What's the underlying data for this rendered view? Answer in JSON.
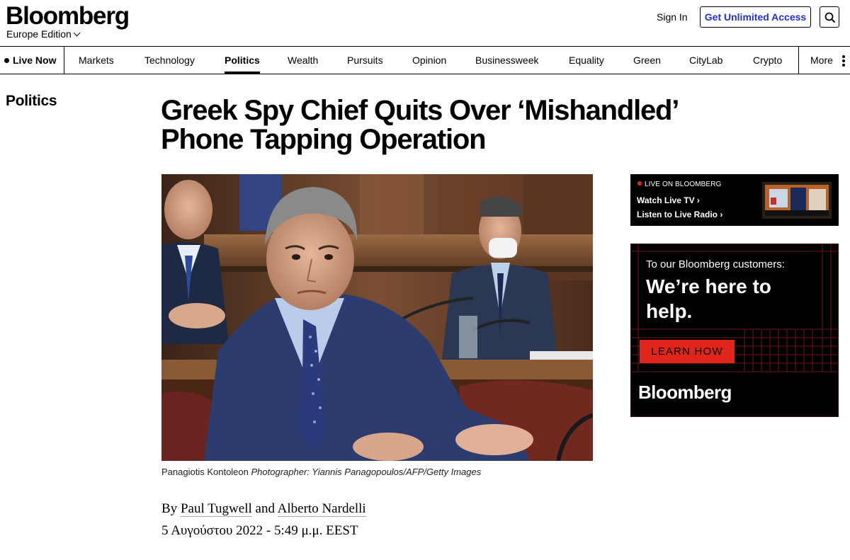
{
  "header": {
    "logo": "Bloomberg",
    "edition": "Europe Edition",
    "sign_in": "Sign In",
    "cta": "Get Unlimited Access",
    "search_icon": "search-icon"
  },
  "nav": {
    "live_now": "Live Now",
    "items": [
      "Markets",
      "Technology",
      "Politics",
      "Wealth",
      "Pursuits",
      "Opinion",
      "Businessweek",
      "Equality",
      "Green",
      "CityLab",
      "Crypto"
    ],
    "active": "Politics",
    "more": "More"
  },
  "article": {
    "section": "Politics",
    "headline": "Greek Spy Chief Quits Over ‘Mishandled’ Phone Tapping Operation",
    "caption_name": "Panagiotis Kontoleon",
    "caption_credit": "Photographer: Yiannis Panagopoulos/AFP/Getty Images",
    "byline_prefix": "By",
    "author1": "Paul Tugwell",
    "byline_and": "and",
    "author2": "Alberto Nardelli",
    "date": "5 Αυγούστου 2022 - 5:49 μ.μ. EEST"
  },
  "live": {
    "label": "LIVE ON BLOOMBERG",
    "tv": "Watch Live TV",
    "radio": "Listen to Live Radio"
  },
  "ad": {
    "line1": "To our Bloomberg customers:",
    "line2": "We’re here to help.",
    "button": "LEARN HOW",
    "brand": "Bloomberg"
  },
  "colors": {
    "cta_text": "#2030e0",
    "accent_red": "#e0251b"
  }
}
